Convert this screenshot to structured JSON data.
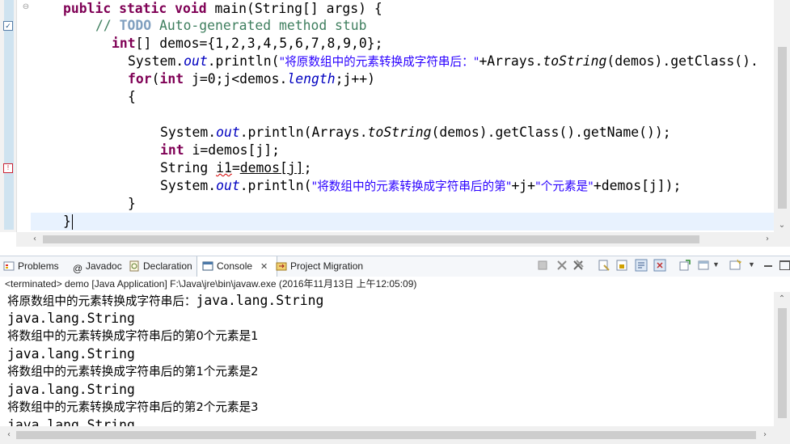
{
  "editor": {
    "lines": {
      "l1_kw": "public static void",
      "l1_rest": " main(String[] args) {",
      "l2_slashes": "// ",
      "l2_todo": "TODO",
      "l2_rest": " Auto-generated method stub",
      "l3_kw": "int",
      "l3_rest": "[] demos={1,2,3,4,5,6,7,8,9,0};",
      "l4_a": "System.",
      "l4_out": "out",
      "l4_b": ".println(",
      "l4_str": "\"将原数组中的元素转换成字符串后：\"",
      "l4_c": "+Arrays.",
      "l4_tostring": "toString",
      "l4_d": "(demos).getClass().",
      "l5_for": "for",
      "l5_a": "(",
      "l5_int": "int",
      "l5_b": " j=0;j<demos.",
      "l5_length": "length",
      "l5_c": ";j++)",
      "l6": "{",
      "l8_a": "System.",
      "l8_out": "out",
      "l8_b": ".println(Arrays.",
      "l8_tostring": "toString",
      "l8_c": "(demos).getClass().getName());",
      "l9_int": "int",
      "l9_rest": " i=demos[j];",
      "l10_a": "String ",
      "l10_i1": "i1",
      "l10_b": "=",
      "l10_demos": "demos[j]",
      "l10_c": ";",
      "l11_a": "System.",
      "l11_out": "out",
      "l11_b": ".println(",
      "l11_str1": "\"将数组中的元素转换成字符串后的第\"",
      "l11_c": "+j+",
      "l11_str2": "\"个元素是\"",
      "l11_d": "+demos[j]);",
      "l12": "}",
      "l13": "}"
    }
  },
  "views": {
    "problems": "Problems",
    "javadoc": "Javadoc",
    "declaration": "Declaration",
    "console": "Console",
    "console_close": "✕",
    "project_migration": "Project Migration"
  },
  "console": {
    "status": "<terminated> demo [Java Application] F:\\Java\\jre\\bin\\javaw.exe (2016年11月13日 上午12:05:09)",
    "first_prefix": "将原数组中的元素转换成字符串后：",
    "first_suffix": "java.lang.String",
    "class_name": "java.lang.String",
    "elem_lines": [
      "将数组中的元素转换成字符串后的第0个元素是1",
      "将数组中的元素转换成字符串后的第1个元素是2",
      "将数组中的元素转换成字符串后的第2个元素是3"
    ],
    "partial_line": "java.lang.String"
  },
  "colors": {
    "keyword": "#7f0055",
    "comment": "#3f7f5f",
    "string": "#2a00ff",
    "field": "#0000c0",
    "current_line": "#e8f2fe"
  }
}
